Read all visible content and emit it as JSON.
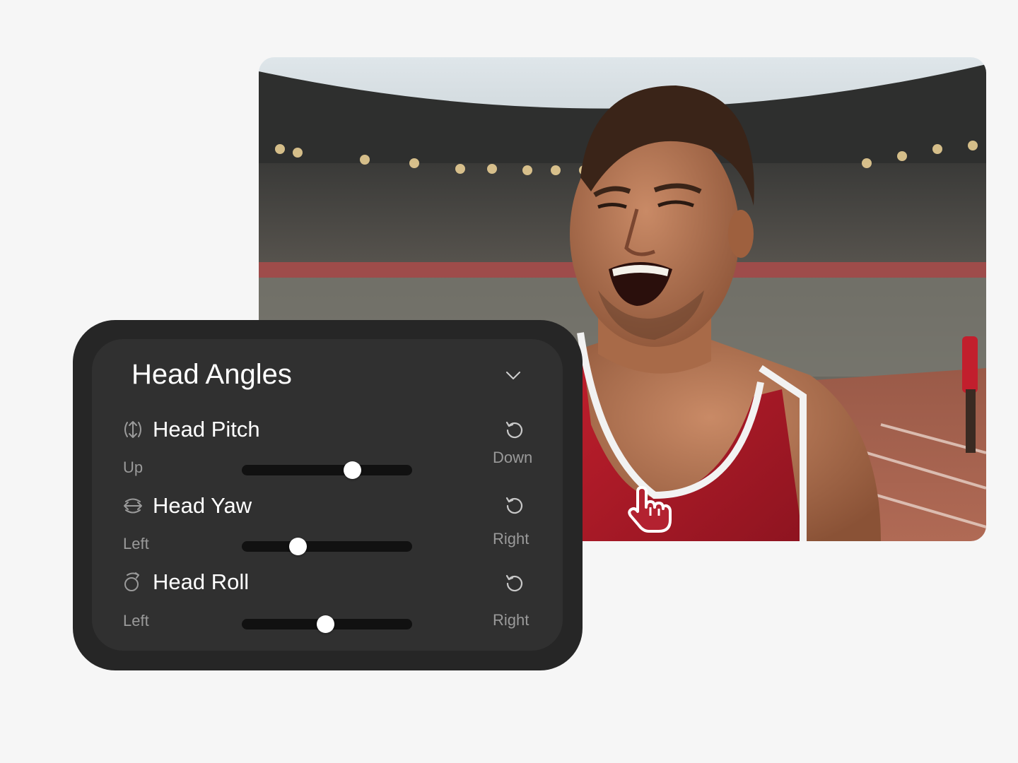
{
  "panel": {
    "title": "Head Angles",
    "controls": [
      {
        "name": "Head Pitch",
        "icon": "pitch-icon",
        "min_label": "Up",
        "max_label": "Down",
        "value": 0.65
      },
      {
        "name": "Head Yaw",
        "icon": "yaw-icon",
        "min_label": "Left",
        "max_label": "Right",
        "value": 0.33
      },
      {
        "name": "Head Roll",
        "icon": "roll-icon",
        "min_label": "Left",
        "max_label": "Right",
        "value": 0.49
      }
    ]
  },
  "icons": {
    "collapse": "chevron-down-icon",
    "reset": "reset-icon",
    "cursor": "hand-pointer-icon"
  },
  "colors": {
    "page_background": "#f6f6f6",
    "panel_outer": "#262626",
    "panel_inner": "#303030",
    "slider_track": "#111111",
    "slider_thumb": "#ffffff",
    "label_muted": "#9a9a9a"
  }
}
